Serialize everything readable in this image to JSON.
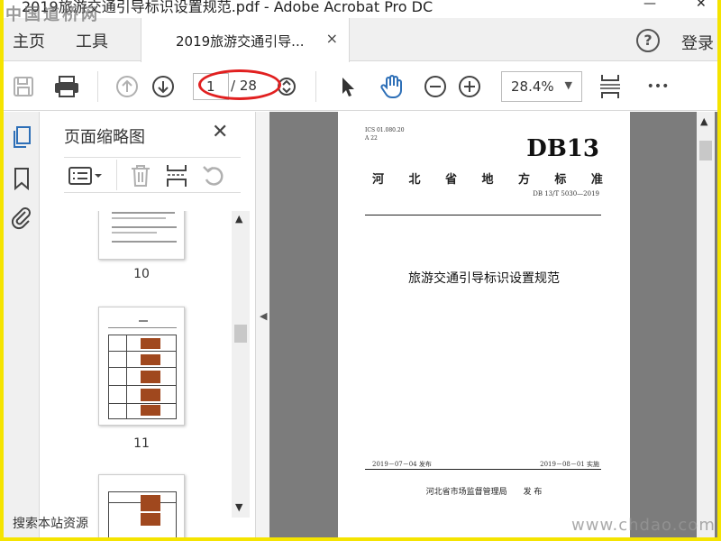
{
  "window": {
    "title": "2019旅游交通引导标识设置规范.pdf - Adobe Acrobat Pro DC",
    "minimize": "—",
    "close": "✕"
  },
  "menubar": {
    "home": "主页",
    "tools": "工具",
    "tab_label": "2019旅游交通引导...",
    "tab_close": "×",
    "help": "?",
    "login": "登录"
  },
  "toolbar": {
    "page_current": "1",
    "page_total": "/ 28",
    "zoom": "28.4%",
    "more": "•••"
  },
  "panel": {
    "title": "页面缩略图",
    "close": "✕",
    "thumbs": [
      {
        "label": "10"
      },
      {
        "label": "11"
      }
    ]
  },
  "document": {
    "ics": "ICS 01.080.20",
    "code": "A 22",
    "db": "DB13",
    "province_chars": [
      "河",
      "北",
      "省",
      "地",
      "方",
      "标",
      "准"
    ],
    "number": "DB 13/T 5030—2019",
    "title": "旅游交通引导标识设置规范",
    "published": "2019－07－04 发布",
    "implemented": "2019－08－01 实施",
    "issuer": "河北省市场监督管理局　　发 布"
  },
  "watermarks": {
    "top_left": "中国道桥网",
    "bottom_left": "搜索本站资源",
    "bottom_right": "www.chdao.com"
  },
  "colors": {
    "frame": "#f5e400",
    "annotation": "#e12020",
    "accent": "#2d6fb7"
  }
}
